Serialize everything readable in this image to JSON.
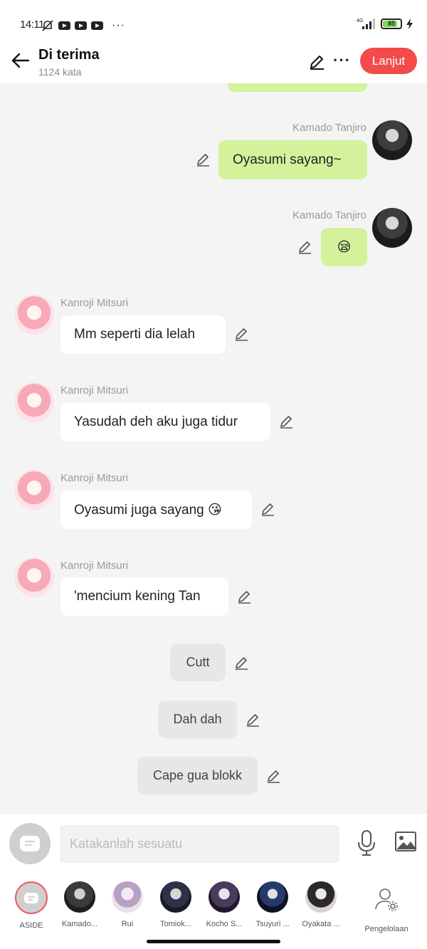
{
  "status_bar": {
    "time": "14:11",
    "network": "4G",
    "battery": "85",
    "battery_level": 0.85
  },
  "header": {
    "title": "Di terima",
    "subtitle": "1124 kata",
    "next_label": "Lanjut"
  },
  "messages": [
    {
      "sender": "",
      "side": "mine",
      "text": ""
    },
    {
      "sender": "Kamado Tanjiro",
      "side": "mine",
      "text": "Oyasumi sayang~"
    },
    {
      "sender": "Kamado Tanjiro",
      "side": "mine",
      "text": "😪"
    },
    {
      "sender": "Kanroji Mitsuri",
      "side": "theirs",
      "text": "Mm seperti dia lelah"
    },
    {
      "sender": "Kanroji Mitsuri",
      "side": "theirs",
      "text": "Yasudah deh aku juga tidur"
    },
    {
      "sender": "Kanroji Mitsuri",
      "side": "theirs",
      "text": "Oyasumi juga sayang 😘"
    },
    {
      "sender": "Kanroji Mitsuri",
      "side": "theirs",
      "text": "'mencium kening Tan"
    },
    {
      "sender": "",
      "side": "narration",
      "text": "Cutt"
    },
    {
      "sender": "",
      "side": "narration",
      "text": "Dah dah"
    },
    {
      "sender": "",
      "side": "narration",
      "text": "Cape gua blokk"
    }
  ],
  "input": {
    "placeholder": "Katakanlah sesuatu"
  },
  "characters": [
    {
      "label": "ASIDE",
      "active": true
    },
    {
      "label": "Kamado...",
      "active": false
    },
    {
      "label": "Rui",
      "active": false
    },
    {
      "label": "Tomiok...",
      "active": false
    },
    {
      "label": "Kocho S...",
      "active": false
    },
    {
      "label": "Tsuyuri ...",
      "active": false
    },
    {
      "label": "Oyakata ...",
      "active": false
    }
  ],
  "management_label": "Pengelolaan",
  "colors": {
    "accent": "#f34b4b",
    "my_bubble": "#d4f29b",
    "their_bubble": "#ffffff",
    "narration_bubble": "#e7e7e7"
  },
  "icons": [
    "back-arrow-icon",
    "pencil-icon",
    "more-icon",
    "chat-icon",
    "microphone-icon",
    "image-icon",
    "person-settings-icon"
  ]
}
